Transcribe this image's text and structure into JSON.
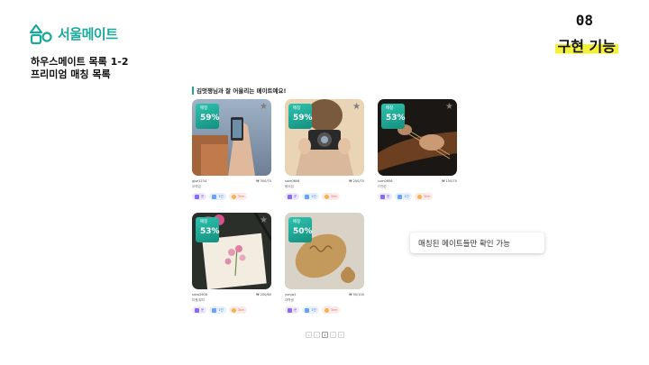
{
  "brand": {
    "name": "서울메이트",
    "accent": "#1aa99b"
  },
  "slide": {
    "title_line1": "하우스메이트 목록 1-2",
    "title_line2": "프리미엄 매칭 목록",
    "section_number": "08",
    "section_name": "구현 기능",
    "highlight_color": "#f3f03c"
  },
  "list": {
    "heading": "김멋쟁님과 잘 어울리는 메이트예요!",
    "badge_label": "매칭",
    "cards": [
      {
        "match": "59%",
        "name": "gjse1234",
        "price": "₩ 300/70",
        "sub": "무역업",
        "chips": [
          "운",
          "1인",
          "3km"
        ]
      },
      {
        "match": "59%",
        "name": "sare0606",
        "price": "₩ 200/70",
        "sub": "봉사업",
        "chips": [
          "운",
          "1인",
          "3km"
        ]
      },
      {
        "match": "53%",
        "name": "cum0606",
        "price": "₩ 150/70",
        "sub": "IT관련",
        "chips": [
          "운",
          "1인",
          "3km"
        ]
      },
      {
        "match": "53%",
        "name": "smw2606",
        "price": "₩ 200/60",
        "sub": "미용/뷰티",
        "chips": [
          "운",
          "1인",
          "3km"
        ]
      },
      {
        "match": "50%",
        "name": "yunjw1",
        "price": "₩ 50/100",
        "sub": "대학생",
        "chips": [
          "운",
          "1인",
          "3km"
        ]
      }
    ]
  },
  "tooltip": "매칭된 메이트들만 확인 가능",
  "pagination": [
    "«",
    "‹",
    "1",
    "›",
    "»"
  ],
  "icons": {
    "favorite": "star-icon",
    "logo": "house-logo-icon"
  }
}
